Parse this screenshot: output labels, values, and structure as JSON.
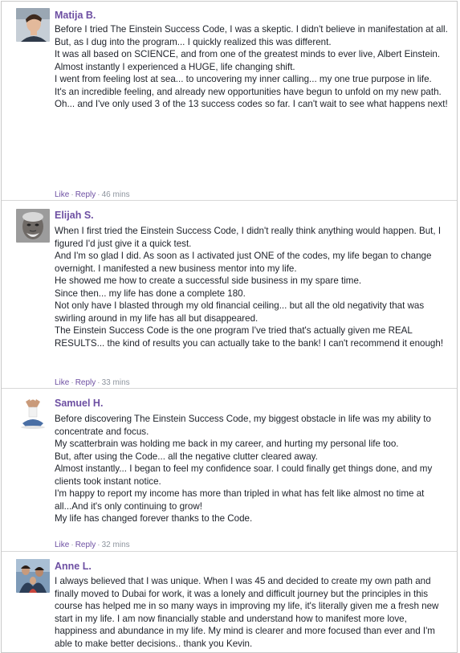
{
  "comments": [
    {
      "name": "Matija B.",
      "avatar": "young-man-avatar",
      "paragraphs": [
        "Before I tried The Einstein Success Code, I was a skeptic. I didn't believe in manifestation at all.",
        "But, as I dug into the program... I quickly realized this was different.",
        "It was all based on SCIENCE, and from one of the greatest minds to ever live, Albert Einstein.",
        "Almost instantly I experienced a HUGE, life changing shift.",
        "I went from feeling lost at sea... to uncovering my inner calling... my one true purpose in life.",
        "It's an incredible feeling, and already new opportunities have begun to unfold on my new path.",
        "Oh... and I've only used 3 of the 13 success codes so far. I can't wait to see what happens next!"
      ],
      "like": "Like",
      "reply": "Reply",
      "time": "46 mins"
    },
    {
      "name": "Elijah S.",
      "avatar": "elderly-man-avatar",
      "paragraphs": [
        "When I first tried the Einstein Success Code, I didn't really think anything would happen. But, I figured I'd just give it a quick test.",
        "And I'm so glad I did. As soon as I activated just ONE of the codes, my life began to change overnight. I manifested a new business mentor into my life.",
        "He showed me how to create a successful side business in my spare time.",
        "Since then... my life has done a complete 180.",
        "Not only have I blasted through my old financial ceiling... but all the old negativity that was swirling around in my life has all but disappeared.",
        "The Einstein Success Code is the one program I've tried that's actually given me REAL RESULTS... the kind of results you can actually take to the bank! I can't recommend it enough!"
      ],
      "like": "Like",
      "reply": "Reply",
      "time": "33 mins"
    },
    {
      "name": "Samuel H.",
      "avatar": "meditating-man-avatar",
      "paragraphs": [
        "Before discovering The Einstein Success Code, my biggest obstacle in life was my ability to concentrate and focus.",
        "My scatterbrain was holding me back in my career, and hurting my personal life too.",
        "But, after using the Code... all the negative clutter cleared away.",
        "Almost instantly... I began to feel my confidence soar. I could finally get things done, and my clients took instant notice.",
        "I'm happy to report my income has more than tripled in what has felt like almost no time at all...And it's only continuing to grow!",
        "My life has changed forever thanks to the Code."
      ],
      "like": "Like",
      "reply": "Reply",
      "time": "32 mins"
    },
    {
      "name": "Anne L.",
      "avatar": "family-avatar",
      "paragraphs": [
        "I always believed that I was unique. When I was 45 and decided to create my own path and finally moved to Dubai for work, it was a lonely and difficult journey but the principles in this course has helped me in so many ways in improving my life, it's literally given me a fresh new start in my life. I am now financially stable and understand how to manifest more love, happiness and abundance in my life. My mind is clearer and more focused than ever and I'm able to make better decisions.. thank you Kevin."
      ]
    }
  ]
}
